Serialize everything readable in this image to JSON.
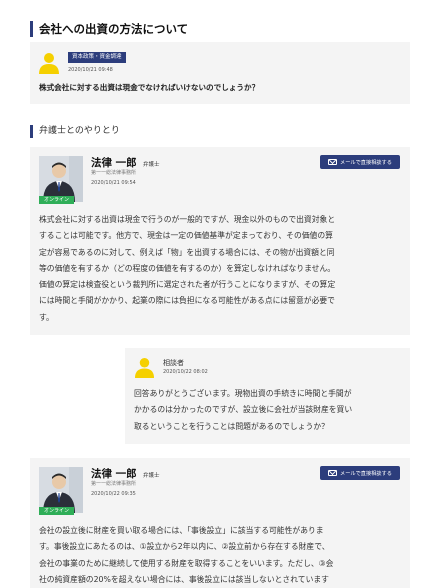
{
  "header": {
    "title": "会社への出資の方法について"
  },
  "question": {
    "category": "資本政策・資金調達",
    "timestamp": "2020/10/21 09:48",
    "text": "株式会社に対する出資は現金でなければいけないのでしょうか？"
  },
  "exchange": {
    "heading": "弁護士とのやりとり"
  },
  "answer1": {
    "name": "法律 一郎",
    "title": "弁護士",
    "office": "第一一総法律事務所",
    "timestamp": "2020/10/21 09:54",
    "online": "オンライン",
    "mail_button": "メールで直接相談する",
    "lines": [
      "株式会社に対する出資は現金で行うのが一般的ですが、現金以外のもので出資対象と",
      "することは可能です。他方で、現金は一定の価値基準が定まっており、その価値の算",
      "定が容易であるのに対して、例えば「物」を出資する場合には、その物が出資額と同",
      "等の価値を有するか（どの程度の価値を有するのか）を算定しなければなりません。",
      "価値の算定は検査役という裁判所に選定された者が行うことになりますが、その算定",
      "には時間と手間がかかり、起業の際には負担になる可能性がある点には留意が必要で",
      "す。"
    ]
  },
  "reply": {
    "label": "相談者",
    "timestamp": "2020/10/22 08:02",
    "lines": [
      "回答ありがとうございます。現物出資の手続きに時間と手間が",
      "かかるのは分かったのですが、設立後に会社が当該財産を買い",
      "取るということを行うことは問題があるのでしょうか？"
    ]
  },
  "answer2": {
    "name": "法律 一郎",
    "title": "弁護士",
    "office": "第一一総法律事務所",
    "timestamp": "2020/10/22 09:35",
    "online": "オンライン",
    "mail_button": "メールで直接相談する",
    "lines": [
      "会社の設立後に財産を買い取る場合には、「事後設立」に該当する可能性がありま",
      "す。事後設立にあたるのは、①設立から2年以内に、②設立前から存在する財産で、",
      "会社の事業のために継続して使用する財産を取得することをいいます。ただし、③会",
      "社の純資産額の20%を超えない場合には、事後設立には該当しないとされています"
    ]
  },
  "colors": {
    "accent": "#2c3d7c",
    "online": "#2fae58",
    "card_bg": "#f4f4f4"
  },
  "icons": {
    "avatar": "person-avatar-icon",
    "mail": "mail-icon"
  }
}
